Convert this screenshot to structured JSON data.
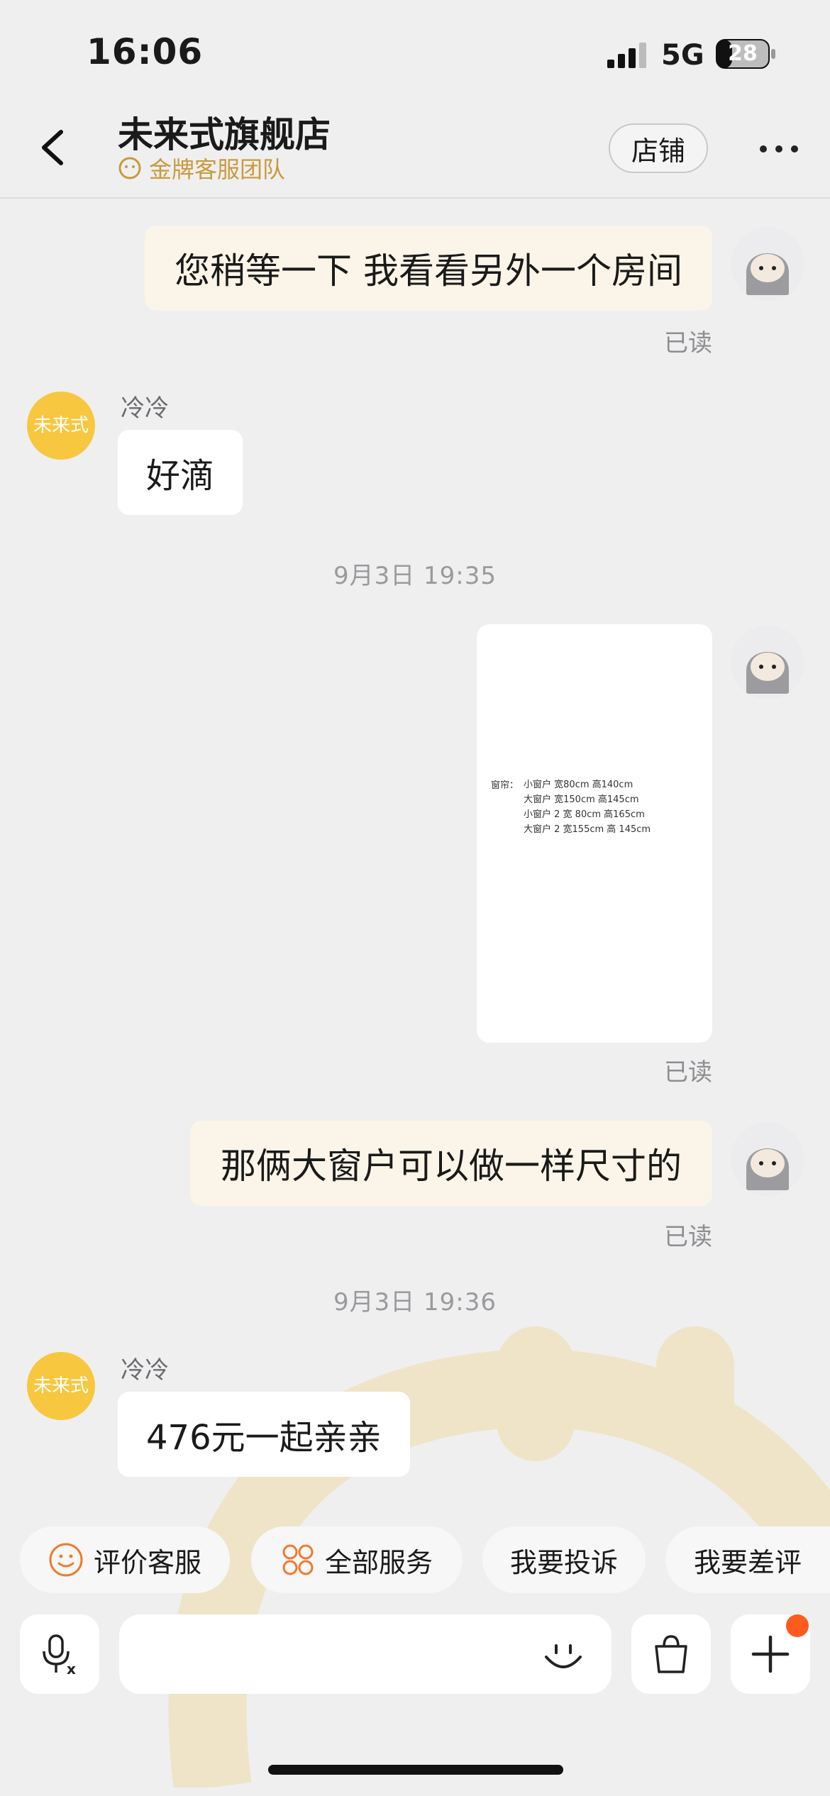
{
  "status_bar": {
    "time": "16:06",
    "network": "5G",
    "battery": "28"
  },
  "header": {
    "title": "未来式旗舰店",
    "subtitle": "金牌客服团队",
    "shop_button": "店铺"
  },
  "messages": {
    "m1": {
      "text": "您稍等一下 我看看另外一个房间",
      "status": "已读"
    },
    "m2": {
      "sender": "冷冷",
      "text": "好滴"
    },
    "ts1": "9月3日 19:35",
    "m3": {
      "status": "已读",
      "image": {
        "label": "窗帘：",
        "lines": [
          "小窗户 宽80cm 高140cm",
          "大窗户 宽150cm 高145cm",
          "小窗户 2 宽 80cm 高165cm",
          "大窗户 2 宽155cm 高 145cm"
        ]
      }
    },
    "m4": {
      "text": "那俩大窗户可以做一样尺寸的",
      "status": "已读"
    },
    "ts2": "9月3日 19:36",
    "m5": {
      "sender": "冷冷",
      "text": "476元一起亲亲"
    }
  },
  "shop_avatar_text": "未来式",
  "quick_actions": [
    "评价客服",
    "全部服务",
    "我要投诉",
    "我要差评"
  ],
  "icons": [
    "back-arrow-icon",
    "more-icon",
    "mic-translate-icon",
    "emoji-icon",
    "bag-icon",
    "plus-icon"
  ],
  "colors": {
    "accent": "#ff5a1f",
    "gold": "#c99a3b",
    "bubble_self": "#faf5e8"
  }
}
